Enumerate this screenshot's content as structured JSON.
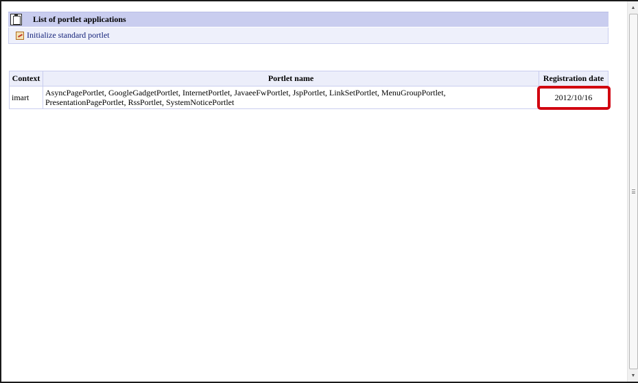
{
  "header": {
    "title": "List of portlet applications",
    "icon": "clipboard-icon"
  },
  "actions": {
    "initialize_link": "Initialize standard portlet",
    "icon": "edit-icon"
  },
  "table": {
    "columns": [
      "Context",
      "Portlet name",
      "Registration date"
    ],
    "rows": [
      {
        "context": "imart",
        "portlets_line1": "AsyncPagePortlet, GoogleGadgetPortlet, InternetPortlet, JavaeeFwPortlet, JspPortlet, LinkSetPortlet, MenuGroupPortlet,",
        "portlets_line2": "PresentationPagePortlet, RssPortlet, SystemNoticePortlet",
        "registration_date": "2012/10/16"
      }
    ]
  },
  "colors": {
    "header_bg": "#c9cdef",
    "link": "#14227a",
    "highlight": "#d1000f"
  }
}
